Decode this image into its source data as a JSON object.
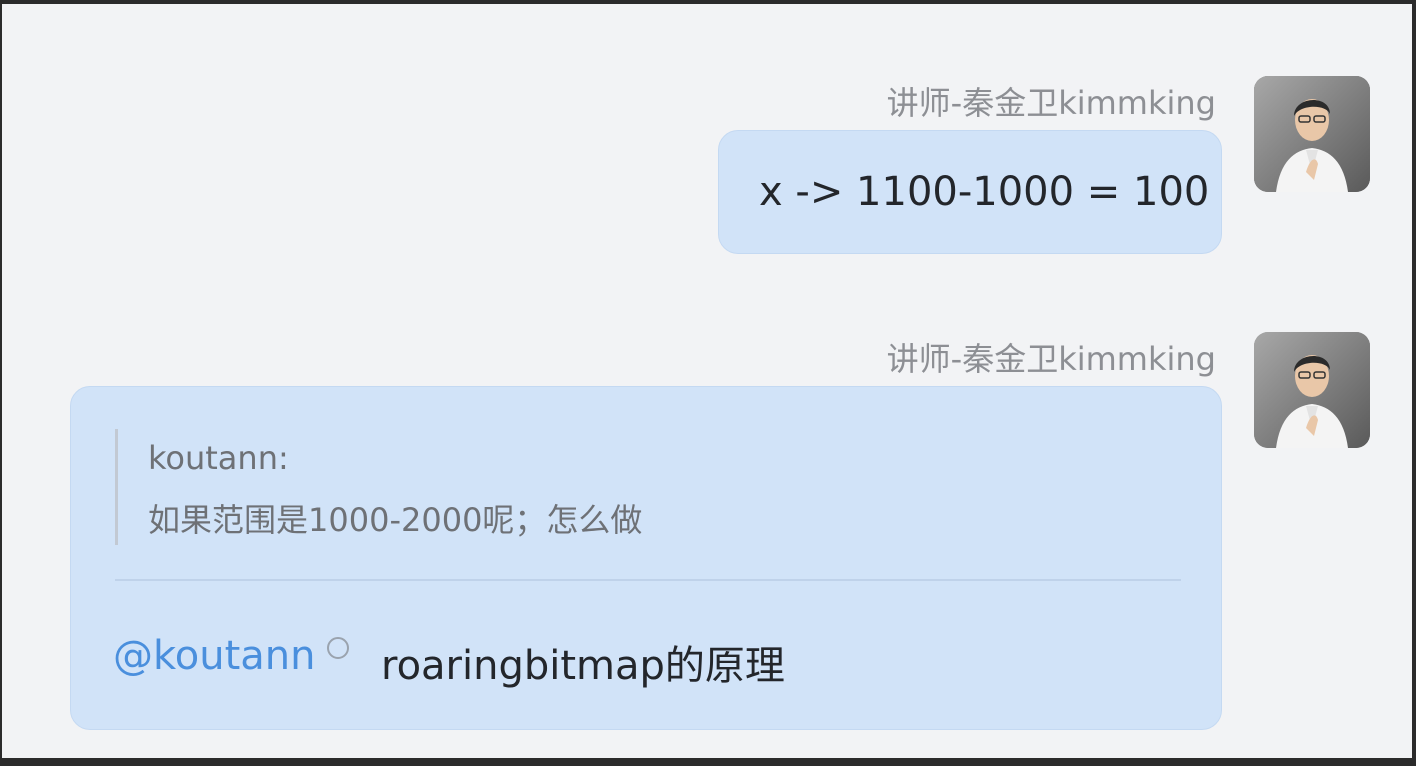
{
  "messages": [
    {
      "sender": "讲师-秦金卫kimmking",
      "text": "x -> 1100-1000 = 100"
    },
    {
      "sender": "讲师-秦金卫kimmking",
      "quote": {
        "author": "koutann:",
        "text": "如果范围是1000-2000呢；怎么做"
      },
      "mention": "@koutann",
      "text": "roaringbitmap的原理"
    }
  ],
  "colors": {
    "chat_background": "#f2f3f5",
    "bubble": "#d1e3f8",
    "mention": "#4a8fdd",
    "sender": "#8d8f94"
  }
}
